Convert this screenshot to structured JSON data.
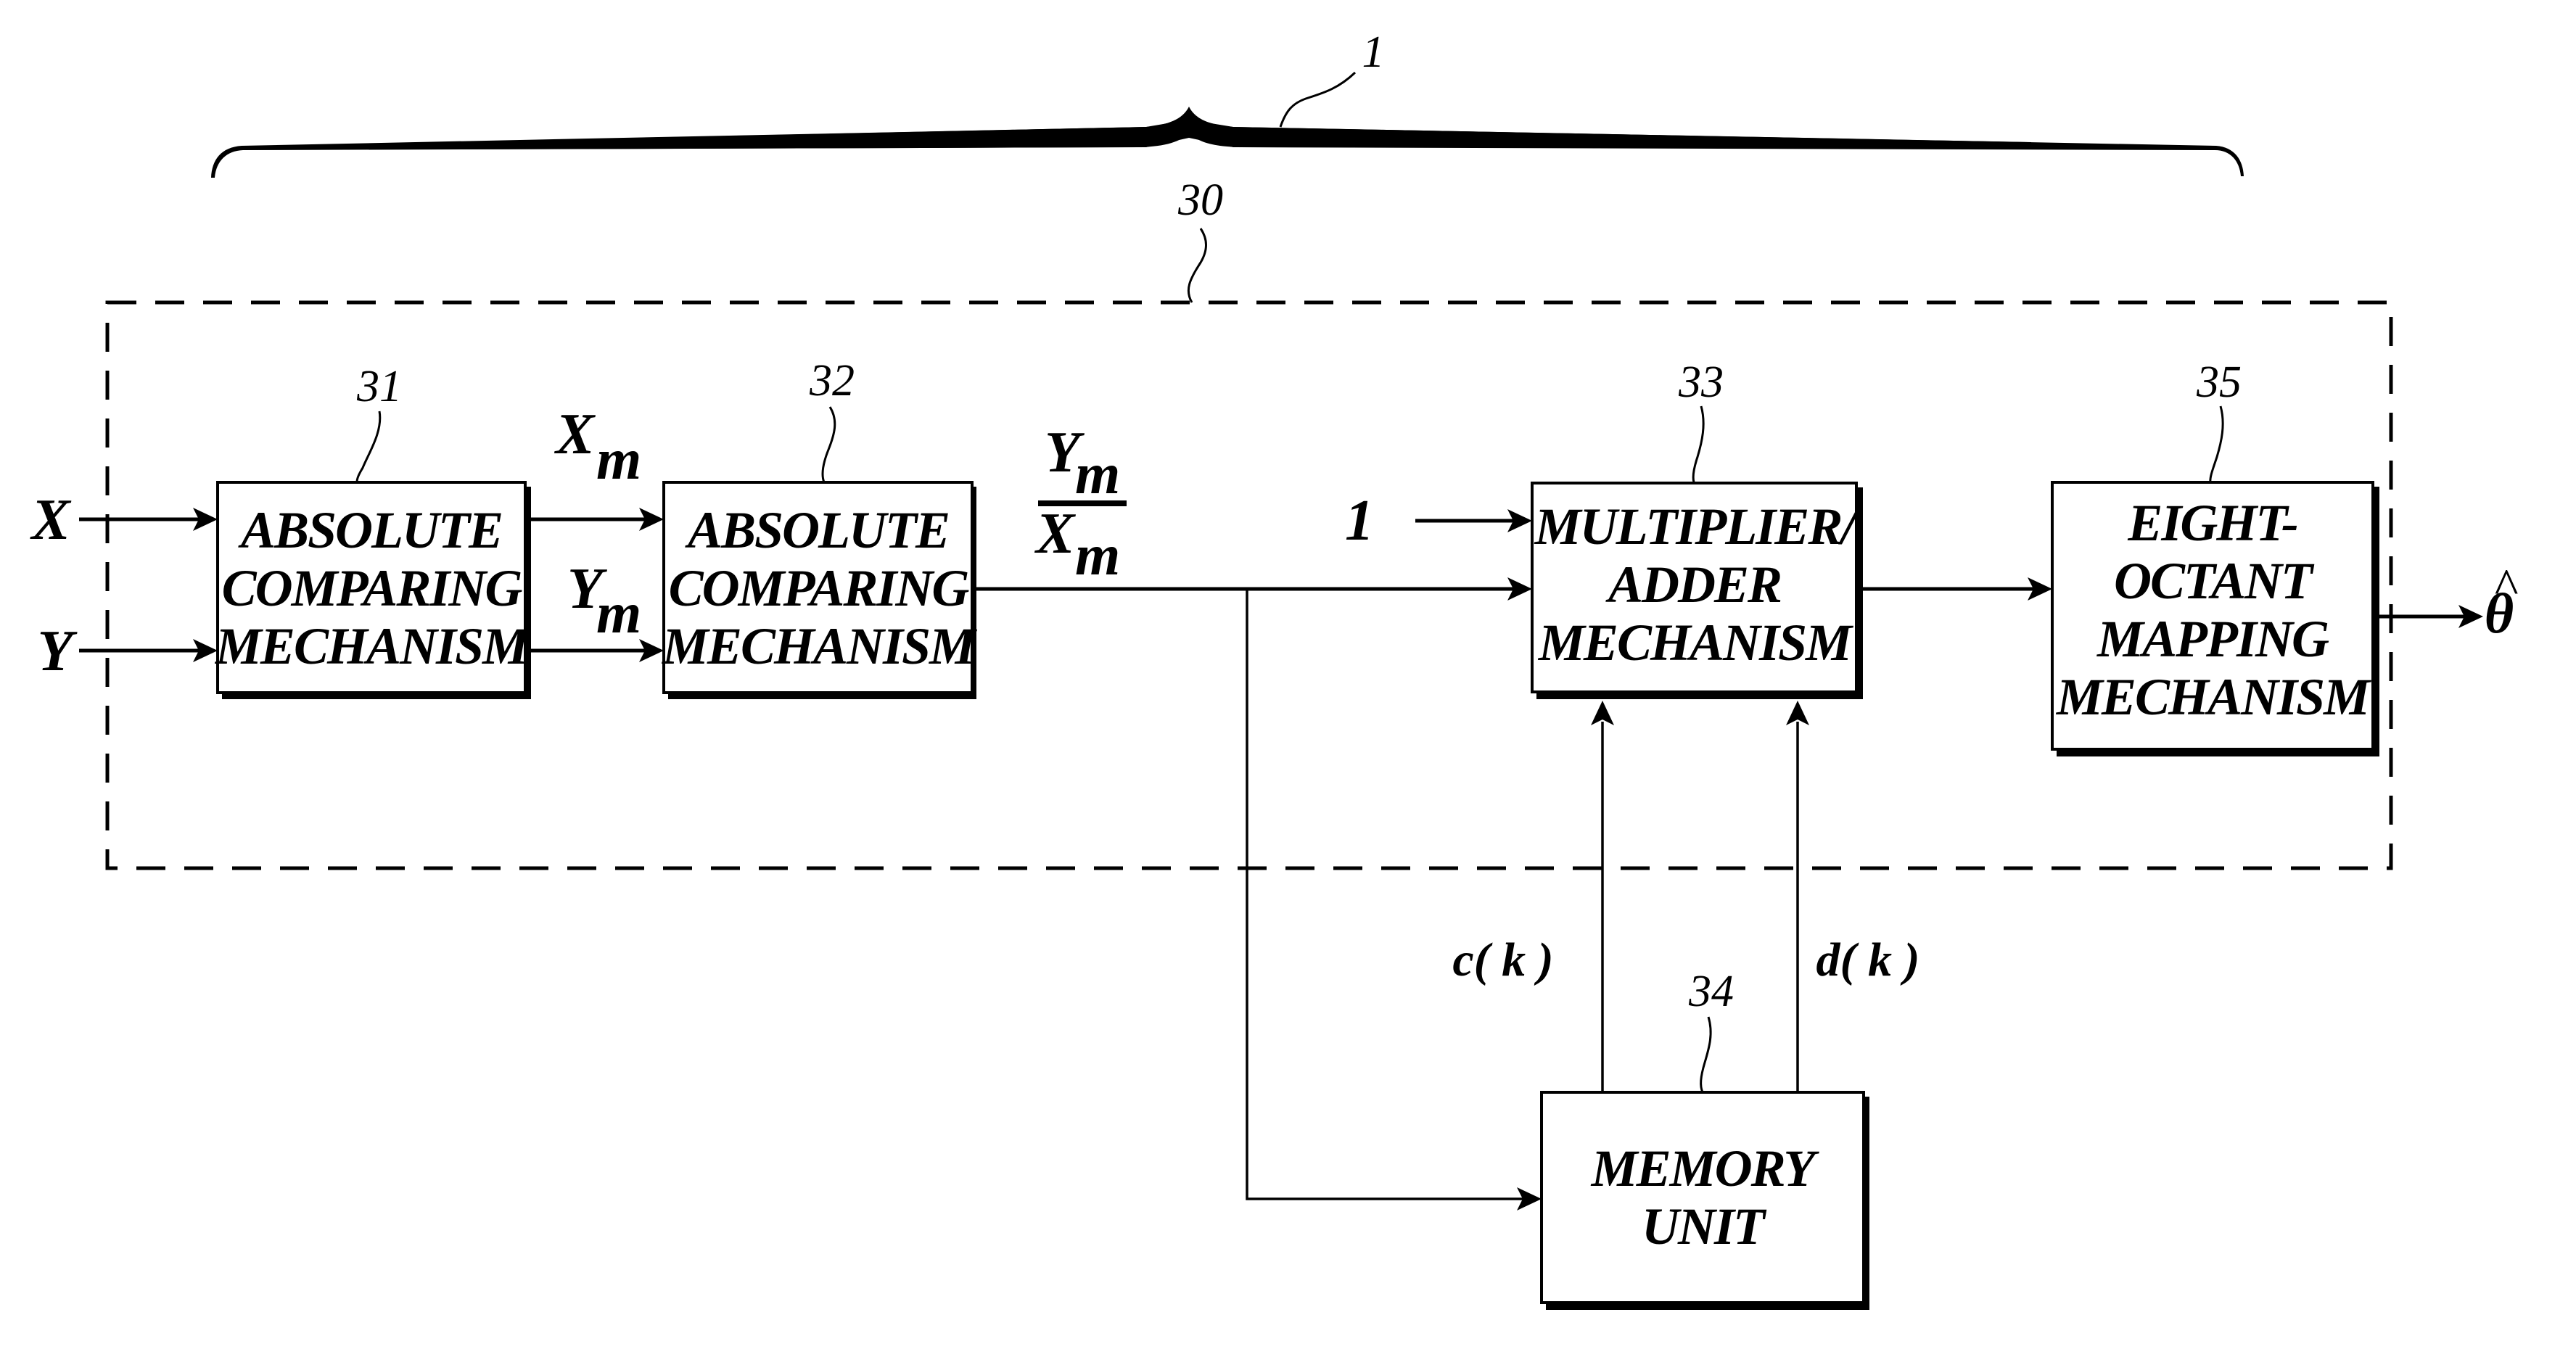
{
  "figure": {
    "system_ref": "1",
    "subsystem_ref": "30",
    "colors": {
      "ink": "#000000",
      "paper": "#ffffff"
    }
  },
  "inputs": {
    "x": "X",
    "y": "Y",
    "one": "1"
  },
  "signals": {
    "xm_main": "X",
    "xm_sub": "m",
    "ym_main": "Y",
    "ym_sub": "m",
    "ratio_num_main": "Y",
    "ratio_num_sub": "m",
    "ratio_den_main": "X",
    "ratio_den_sub": "m",
    "ck": "c( k )",
    "dk": "d( k )",
    "output": "θ",
    "output_hat": "^"
  },
  "blocks": [
    {
      "ref": "31",
      "lines": [
        "ABSOLUTE",
        "COMPARING",
        "MECHANISM"
      ]
    },
    {
      "ref": "32",
      "lines": [
        "ABSOLUTE",
        "COMPARING",
        "MECHANISM"
      ]
    },
    {
      "ref": "33",
      "lines": [
        "MULTIPLIER/",
        "ADDER",
        "MECHANISM"
      ]
    },
    {
      "ref": "34",
      "lines": [
        "MEMORY",
        "UNIT"
      ]
    },
    {
      "ref": "35",
      "lines": [
        "EIGHT-",
        "OCTANT",
        "MAPPING",
        "MECHANISM"
      ]
    }
  ]
}
